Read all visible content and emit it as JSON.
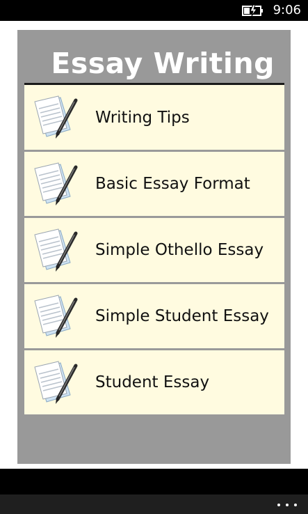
{
  "status_bar": {
    "time": "9:06",
    "battery_icon": "battery-charging-icon"
  },
  "header": {
    "title": "Essay Writing"
  },
  "menu": {
    "item_icon": "document-pen-icon",
    "items": [
      {
        "label": "Writing Tips"
      },
      {
        "label": "Basic Essay Format"
      },
      {
        "label": "Simple Othello Essay"
      },
      {
        "label": "Simple Student Essay"
      },
      {
        "label": "Student Essay"
      }
    ]
  },
  "app_bar": {
    "more_icon": "more-options-icon"
  },
  "colors": {
    "panel": "#999999",
    "item_background": "#fffbe0",
    "title": "#ffffff"
  }
}
